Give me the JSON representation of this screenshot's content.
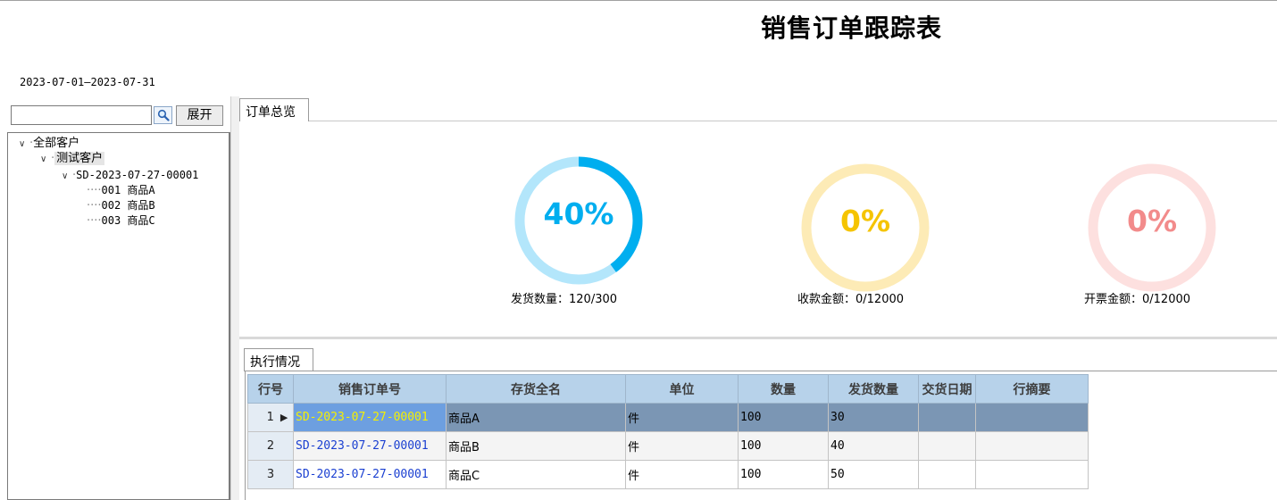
{
  "title": "销售订单跟踪表",
  "date_range": "2023-07-01—2023-07-31",
  "sidebar": {
    "search_placeholder": "",
    "expand_label": "展开",
    "tree": {
      "root": "全部客户",
      "customer": "测试客户",
      "order": "SD-2023-07-27-00001",
      "lines": [
        "001 商品A",
        "002 商品B",
        "003 商品C"
      ]
    }
  },
  "overview": {
    "tab_label": "订单总览",
    "gauges": [
      {
        "percent_text": "40%",
        "value": 0.4,
        "caption": "发货数量：120/300",
        "color": "#00aeef",
        "track": "#b3e6fb"
      },
      {
        "percent_text": "0%",
        "value": 0,
        "caption": "收款金额：0/12000",
        "color": "#f5c400",
        "track": "#fdebb6"
      },
      {
        "percent_text": "0%",
        "value": 0,
        "caption": "开票金额：0/12000",
        "color": "#f28b8b",
        "track": "#fde0df"
      }
    ]
  },
  "execution": {
    "tab_label": "执行情况",
    "columns": [
      "行号",
      "销售订单号",
      "存货全名",
      "单位",
      "数量",
      "发货数量",
      "交货日期",
      "行摘要"
    ],
    "rows": [
      {
        "no": "1",
        "order": "SD-2023-07-27-00001",
        "item": "商品A",
        "unit": "件",
        "qty": "100",
        "shipped": "30",
        "date": "",
        "note": ""
      },
      {
        "no": "2",
        "order": "SD-2023-07-27-00001",
        "item": "商品B",
        "unit": "件",
        "qty": "100",
        "shipped": "40",
        "date": "",
        "note": ""
      },
      {
        "no": "3",
        "order": "SD-2023-07-27-00001",
        "item": "商品C",
        "unit": "件",
        "qty": "100",
        "shipped": "50",
        "date": "",
        "note": ""
      }
    ]
  }
}
